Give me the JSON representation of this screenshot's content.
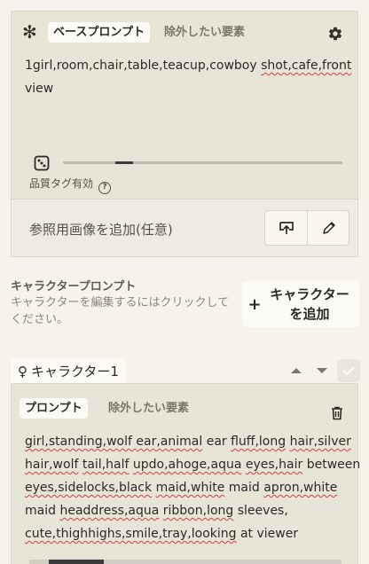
{
  "base_prompt": {
    "tabs": [
      {
        "label": "ベースプロンプト",
        "active": true
      },
      {
        "label": "除外したい要素",
        "active": false
      }
    ],
    "text_lines": [
      [
        {
          "t": "1girl,room,chair,table,teacup,cowboy "
        },
        {
          "t": "shot,cafe,front",
          "u": true
        }
      ],
      [
        {
          "t": "view"
        }
      ]
    ],
    "quality_tag_label": "品質タグ有効",
    "help_icon_glyph": "?",
    "slider_level": 0.24
  },
  "reference_image": {
    "label": "参照用画像を追加(任意)"
  },
  "character_section": {
    "title": "キャラクタープロンプト",
    "description": "キャラクターを編集するにはクリックしてください。",
    "add_button": {
      "plus": "+",
      "label": "キャラクター\nを追加"
    }
  },
  "character": {
    "gender_symbol": "♀",
    "name": "キャラクター1",
    "tabs": [
      {
        "label": "プロンプト",
        "active": true
      },
      {
        "label": "除外したい要素",
        "active": false
      }
    ],
    "text_lines": [
      [
        {
          "t": "girl,standing,wolf ",
          "u": true
        },
        {
          "t": "ear,animal",
          "u": true
        },
        {
          "t": " ear "
        },
        {
          "t": "fluff,long",
          "u": true
        },
        {
          "t": " "
        },
        {
          "t": "hair,silver",
          "u": true
        }
      ],
      [
        {
          "t": "hair,wolf",
          "u": true
        },
        {
          "t": " "
        },
        {
          "t": "tail,half",
          "u": true
        },
        {
          "t": " "
        },
        {
          "t": "updo,ahoge,aqua",
          "u": true
        },
        {
          "t": " "
        },
        {
          "t": "eyes,hair",
          "u": true
        },
        {
          "t": " between"
        }
      ],
      [
        {
          "t": "eyes,sidelocks,black",
          "u": true
        },
        {
          "t": " "
        },
        {
          "t": "maid,white",
          "u": true
        },
        {
          "t": " maid "
        },
        {
          "t": "apron,white",
          "u": true
        }
      ],
      [
        {
          "t": "maid "
        },
        {
          "t": "headdress,aqua",
          "u": true
        },
        {
          "t": " "
        },
        {
          "t": "ribbon,long",
          "u": true
        },
        {
          "t": " sleeves,"
        }
      ],
      [
        {
          "t": "cute,thighhighs,smile,tray,looking",
          "u": true
        },
        {
          "t": " at viewer"
        }
      ]
    ]
  },
  "colors": {
    "page_bg": "#f5f3ec",
    "panel_bg": "#e7e4d8",
    "spellcheck_underline": "#d23d3d",
    "slider_fill": "#3a3a3f"
  }
}
